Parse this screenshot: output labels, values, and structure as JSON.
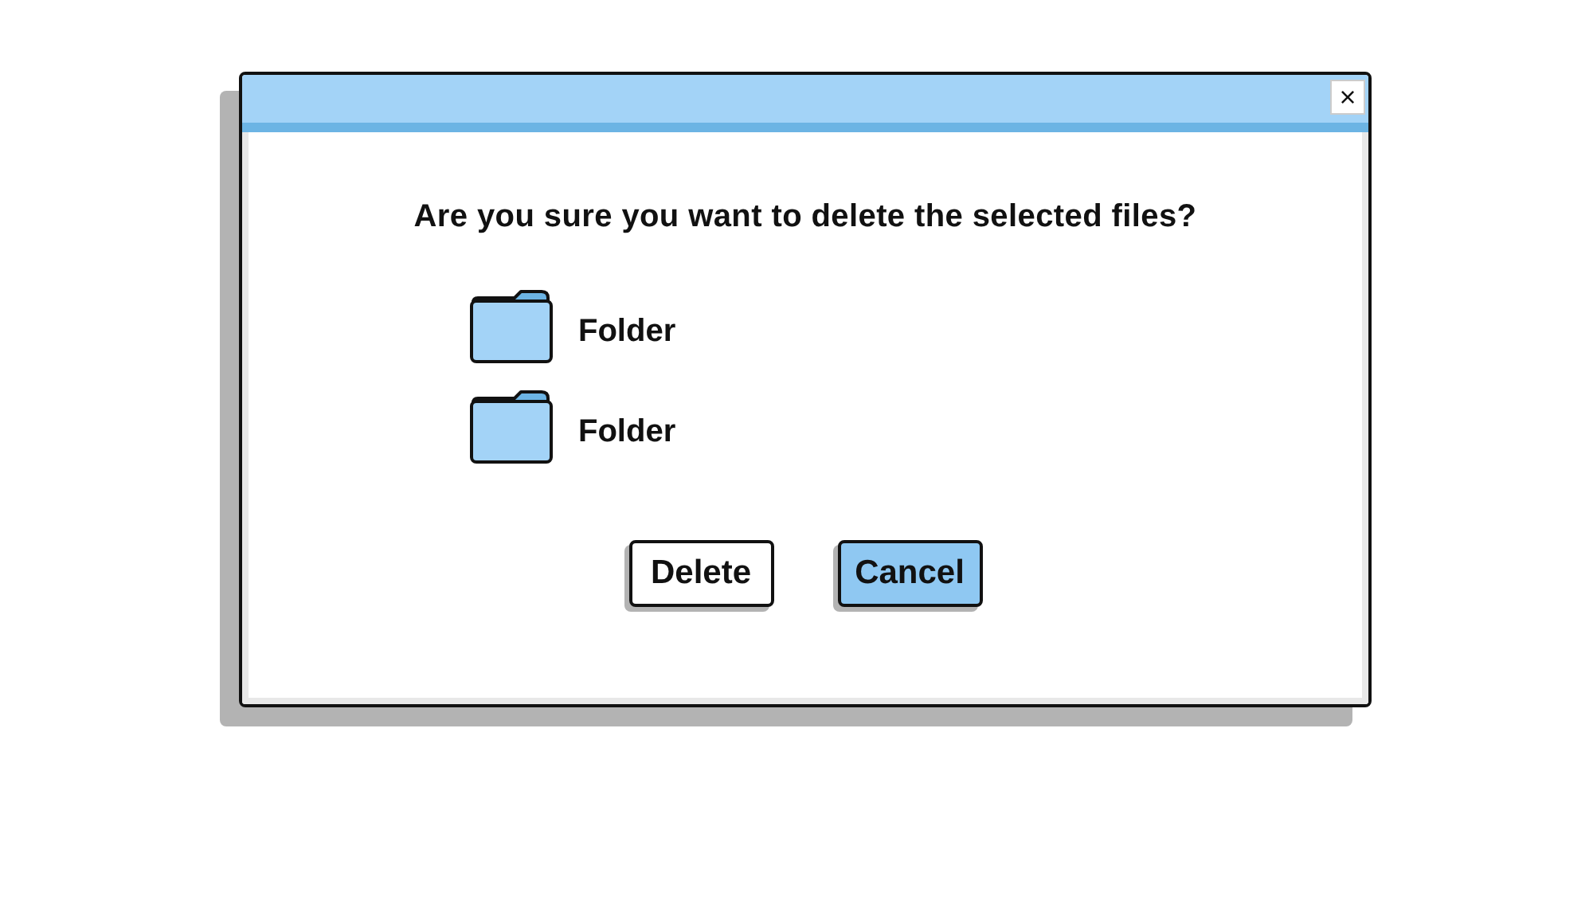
{
  "dialog": {
    "close_glyph": "×",
    "message": "Are you sure you want to delete the selected files?",
    "items": [
      {
        "label": "Folder"
      },
      {
        "label": "Folder"
      }
    ],
    "buttons": [
      {
        "label": "Delete",
        "selected": false
      },
      {
        "label": "Cancel",
        "selected": true
      }
    ]
  }
}
